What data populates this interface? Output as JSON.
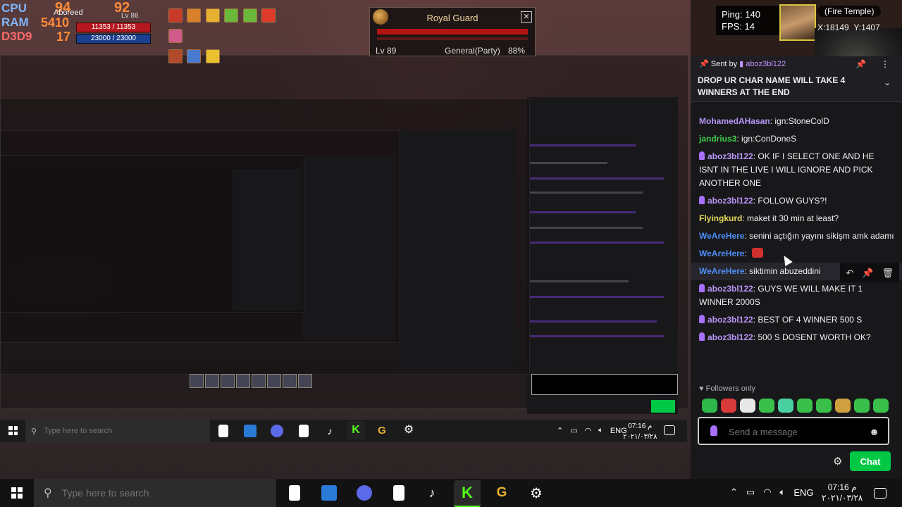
{
  "hud": {
    "cpu_label": "CPU",
    "ram_label": "RAM",
    "d3d_label": "D3D9",
    "cpu_temp": "94",
    "cpu_load": "92",
    "ram_val": "5410",
    "fps": "17",
    "char_name": "Aboreed",
    "level": "Lv 86",
    "hp": "11353 / 11353",
    "mp": "23000 / 23000"
  },
  "target": {
    "name": "Royal Guard",
    "level": "Lv 89",
    "rank": "General(Party)",
    "percent": "88%",
    "close_icon": "✕"
  },
  "netstat": {
    "ping": "Ping: 140",
    "fps": "FPS:  14"
  },
  "minimap": {
    "zone": "(Fire Temple)",
    "x": "X:18149",
    "y": "Y:1407"
  },
  "chat": {
    "pinned": {
      "sent_by_label": "Sent by",
      "user": "aboz3bl122",
      "text": "DROP UR CHAR NAME WILL TAKE 4 WINNERS AT THE END",
      "pin_icon": "📌",
      "menu_icon": "⋮",
      "chevron_icon": "⌄"
    },
    "messages": [
      {
        "user": "MohamedAHasan",
        "color": "purple",
        "mod": false,
        "text": "ign:StoneColD"
      },
      {
        "user": "jandrius3",
        "color": "green",
        "mod": false,
        "text": "ign:ConDoneS"
      },
      {
        "user": "aboz3bl122",
        "color": "purple",
        "mod": true,
        "text": "OK IF I SELECT ONE AND HE ISNT IN THE LIVE I WILL IGNORE AND PICK ANOTHER ONE"
      },
      {
        "user": "aboz3bl122",
        "color": "purple",
        "mod": true,
        "text": "FOLLOW GUYS?!"
      },
      {
        "user": "Flyingkurd",
        "color": "yellow",
        "mod": false,
        "text": "maket it 30 min at least?"
      },
      {
        "user": "WeAreHere",
        "color": "blue",
        "mod": false,
        "text": "senini açtığın yayını sikişm amk adamı"
      },
      {
        "user": "WeAreHere",
        "color": "blue",
        "mod": false,
        "text": "",
        "emote": true
      },
      {
        "user": "WeAreHere",
        "color": "blue",
        "mod": false,
        "text": "siktimin abuzeddini",
        "hover": true
      },
      {
        "user": "aboz3bl122",
        "color": "purple",
        "mod": true,
        "text": "GUYS WE WILL MAKE IT 1 WINNER 2000S"
      },
      {
        "user": "aboz3bl122",
        "color": "purple",
        "mod": true,
        "text": "BEST OF 4 WINNER 500 S"
      },
      {
        "user": "aboz3bl122",
        "color": "purple",
        "mod": true,
        "text": "500 S DOSENT WORTH OK?"
      }
    ],
    "hover_tools": {
      "reply": "↶",
      "pin": "📌",
      "delete": "🗑"
    },
    "followers_only": "Followers only",
    "emote_colors": [
      "#2fb84a",
      "#d93a3a",
      "#e8e8e8",
      "#3ac04a",
      "#4ad0a0",
      "#3ac04a",
      "#3ac04a",
      "#d0a040",
      "#3ac04a",
      "#3ac04a"
    ],
    "input_placeholder": "Send a message",
    "emoji_icon": "☻",
    "gear_icon": "⚙",
    "chat_button": "Chat"
  },
  "taskbar": {
    "search_placeholder": "Type here to search",
    "lang": "ENG",
    "time": "07:16 م",
    "date": "٢٠٢١/٠٣/٢٨"
  },
  "colors": {
    "twitch_purple": "#9146ff",
    "chat_green": "#00c844",
    "chat_bg": "#18181b"
  }
}
